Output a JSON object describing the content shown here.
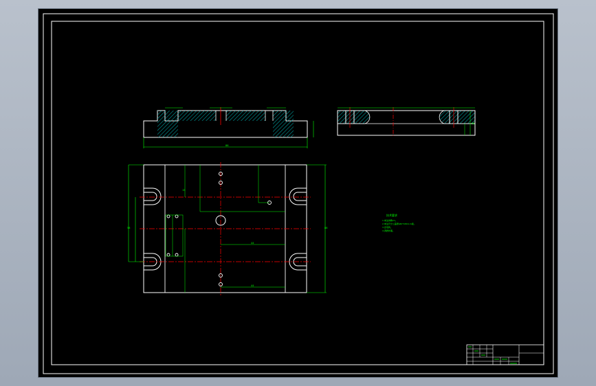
{
  "colors": {
    "background": "#000000",
    "frame": "#ffffff",
    "outline": "#ffffff",
    "dimension": "#00ff00",
    "centerline": "#ff0000",
    "hatch": "#00a0a0",
    "app_bg": "#aab3c0"
  },
  "notes": {
    "title": "技术要求",
    "lines": [
      "1.未注倒角C1。",
      "2.未注尺寸公差按GB/T1804-m级。",
      "3.去毛刺。",
      "4.调质处理。"
    ]
  },
  "dimensions": {
    "front_length": "86",
    "top_width": "88",
    "top_height": "58",
    "right_overall": "58",
    "slot_1": "44",
    "slot_2": "44",
    "hole_offset": "15"
  }
}
